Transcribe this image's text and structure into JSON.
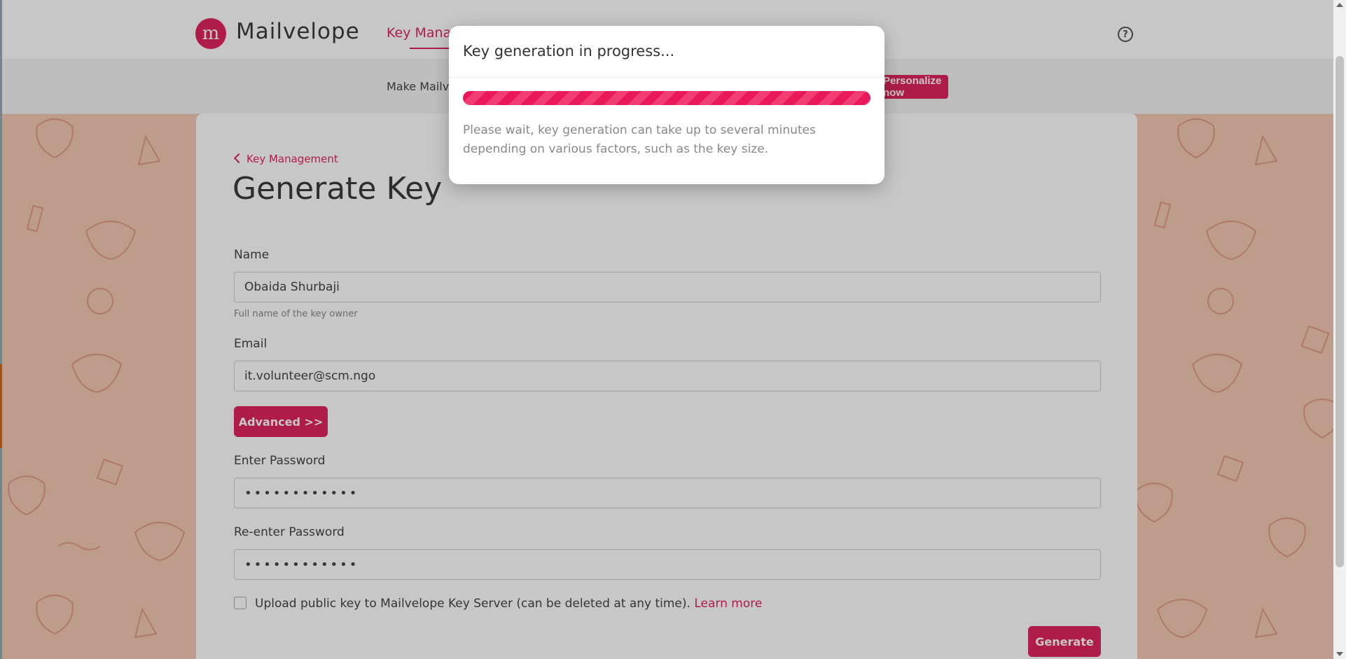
{
  "app": {
    "brand": "Mailvelope",
    "logo_letter": "m"
  },
  "nav": {
    "active_link": "Key Management",
    "help_label": "?"
  },
  "banner": {
    "text": "Make Mailvelope your own",
    "button": "Personalize now"
  },
  "back_link": "Key Management",
  "page_title": "Generate Key",
  "form": {
    "name_label": "Name",
    "name_value": "Obaida Shurbaji",
    "name_help": "Full name of the key owner",
    "email_label": "Email",
    "email_value": "it.volunteer@scm.ngo",
    "advanced_button": "Advanced >>",
    "password_label": "Enter Password",
    "password_value": "••••••••••••",
    "reenter_label": "Re-enter Password",
    "reenter_value": "••••••••••••",
    "upload_label": "Upload public key to Mailvelope Key Server (can be deleted at any time).",
    "learn_more": "Learn more",
    "generate_button": "Generate"
  },
  "modal": {
    "title": "Key generation in progress...",
    "body": "Please wait, key generation can take up to several minutes depending on various factors, such as the key size.",
    "progress": 1.0
  },
  "colors": {
    "accent": "#e0245e",
    "background": "#f2c8b4"
  }
}
